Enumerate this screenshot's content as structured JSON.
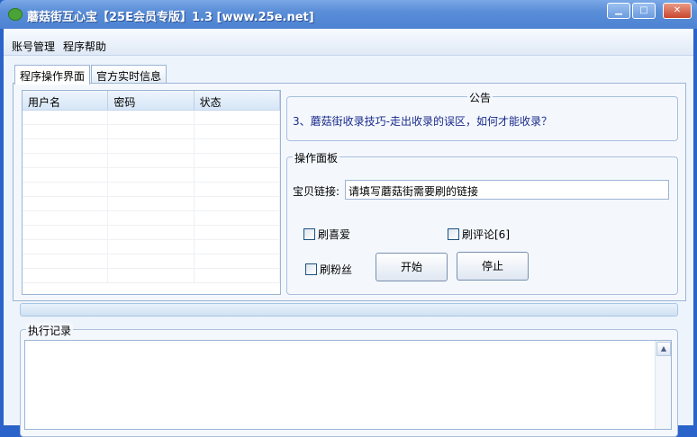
{
  "window": {
    "title": "蘑菇街互心宝【25E会员专版】1.3 [www.25e.net]",
    "minimize": "▁",
    "maximize": "□",
    "close": "✕"
  },
  "menu": [
    "账号管理",
    "程序帮助"
  ],
  "tabs": [
    "程序操作界面",
    "官方实时信息"
  ],
  "table": {
    "columns": [
      "用户名",
      "密码",
      "状态"
    ],
    "rows": []
  },
  "notice": {
    "legend": "公告",
    "text": "3、蘑菇街收录技巧-走出收录的误区，如何才能收录？"
  },
  "ops": {
    "legend": "操作面板",
    "link_label": "宝贝链接:",
    "link_value": "请填写蘑菇街需要刷的链接",
    "cb_like": "刷喜爱",
    "cb_comment": "刷评论[6]",
    "cb_fans": "刷粉丝",
    "start": "开始",
    "stop": "停止"
  },
  "progress": 0,
  "log": {
    "legend": "执行记录",
    "scroll_up": "▲"
  }
}
